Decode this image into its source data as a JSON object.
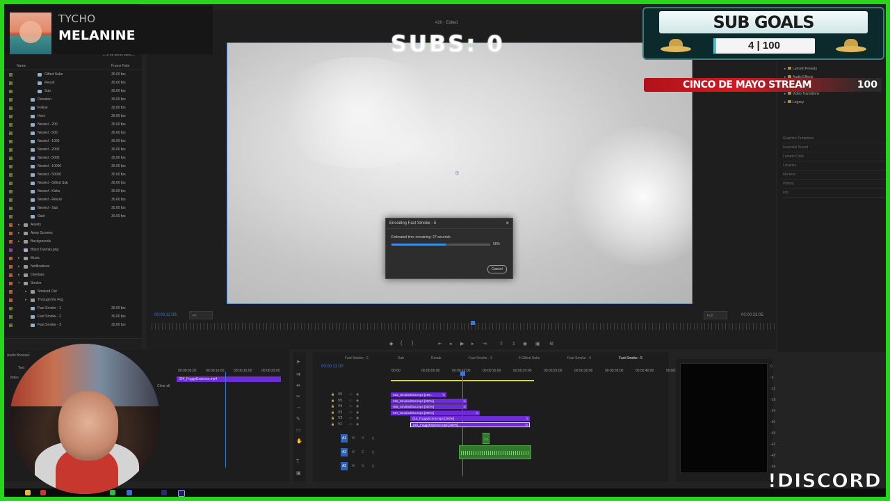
{
  "overlay": {
    "now_playing": {
      "artist": "TYCHO",
      "song": "MELANINE"
    },
    "subs_counter": "SUBS: 0",
    "sub_goals": {
      "title": "SUB GOALS",
      "current": "4",
      "separator": "|",
      "target": "100"
    },
    "stream_goal": {
      "label": "CINCO DE MAYO STREAM",
      "value": "100"
    },
    "discord": "!DISCORD"
  },
  "project_panel": {
    "item_count": "1 of 69 items selec...",
    "columns": {
      "name": "Name",
      "frame_rate": "Frame Rate"
    },
    "items": [
      {
        "name": "Gifted Subs",
        "rate": "30.00 fps",
        "indent": 3,
        "kind": "seq",
        "color": "#5f7f2a"
      },
      {
        "name": "Resub",
        "rate": "30.00 fps",
        "indent": 3,
        "kind": "seq",
        "color": "#5f7f2a"
      },
      {
        "name": "Sub",
        "rate": "30.00 fps",
        "indent": 3,
        "kind": "seq",
        "color": "#5f7f2a"
      },
      {
        "name": "Donation",
        "rate": "30.00 fps",
        "indent": 2,
        "kind": "seq",
        "color": "#5f7f2a"
      },
      {
        "name": "Follow",
        "rate": "30.00 fps",
        "indent": 2,
        "kind": "seq",
        "color": "#5f7f2a"
      },
      {
        "name": "Host",
        "rate": "30.00 fps",
        "indent": 2,
        "kind": "seq",
        "color": "#5f7f2a"
      },
      {
        "name": "Nested - 200",
        "rate": "30.00 fps",
        "indent": 2,
        "kind": "seq",
        "color": "#5f7f2a"
      },
      {
        "name": "Nested - 500",
        "rate": "30.00 fps",
        "indent": 2,
        "kind": "seq",
        "color": "#5f7f2a"
      },
      {
        "name": "Nested - 1000",
        "rate": "30.00 fps",
        "indent": 2,
        "kind": "seq",
        "color": "#5f7f2a"
      },
      {
        "name": "Nested - 2000",
        "rate": "30.00 fps",
        "indent": 2,
        "kind": "seq",
        "color": "#5f7f2a"
      },
      {
        "name": "Nested - 5000",
        "rate": "30.00 fps",
        "indent": 2,
        "kind": "seq",
        "color": "#5f7f2a"
      },
      {
        "name": "Nested - 10000",
        "rate": "30.00 fps",
        "indent": 2,
        "kind": "seq",
        "color": "#5f7f2a"
      },
      {
        "name": "Nested - 50000",
        "rate": "30.00 fps",
        "indent": 2,
        "kind": "seq",
        "color": "#5f7f2a"
      },
      {
        "name": "Nested - Gifted Sub",
        "rate": "30.00 fps",
        "indent": 2,
        "kind": "seq",
        "color": "#5f7f2a"
      },
      {
        "name": "Nested - Kicks",
        "rate": "30.00 fps",
        "indent": 2,
        "kind": "seq",
        "color": "#5f7f2a"
      },
      {
        "name": "Nested - Resub",
        "rate": "30.00 fps",
        "indent": 2,
        "kind": "seq",
        "color": "#5f7f2a"
      },
      {
        "name": "Nested - Sub",
        "rate": "30.00 fps",
        "indent": 2,
        "kind": "seq",
        "color": "#5f7f2a"
      },
      {
        "name": "Raid",
        "rate": "30.00 fps",
        "indent": 2,
        "kind": "seq",
        "color": "#5f7f2a"
      },
      {
        "name": "Assets",
        "rate": "",
        "indent": 1,
        "kind": "bin",
        "color": "#c05a2b"
      },
      {
        "name": "Away Screens",
        "rate": "",
        "indent": 1,
        "kind": "bin",
        "color": "#c05a2b"
      },
      {
        "name": "Backgrounds",
        "rate": "",
        "indent": 1,
        "kind": "bin",
        "color": "#c05a2b"
      },
      {
        "name": "Black Overlay.png",
        "rate": "",
        "indent": 1,
        "kind": "img",
        "color": "#8a3ab0"
      },
      {
        "name": "Music",
        "rate": "",
        "indent": 1,
        "kind": "bin",
        "color": "#c05a2b"
      },
      {
        "name": "Notifications",
        "rate": "",
        "indent": 1,
        "kind": "bin",
        "color": "#c05a2b"
      },
      {
        "name": "Overlays",
        "rate": "",
        "indent": 1,
        "kind": "bin",
        "color": "#c05a2b"
      },
      {
        "name": "Smoke",
        "rate": "",
        "indent": 1,
        "kind": "bin-open",
        "color": "#c05a2b"
      },
      {
        "name": "Smoked Out",
        "rate": "",
        "indent": 2,
        "kind": "bin",
        "color": "#c05a2b"
      },
      {
        "name": "Through the Fog",
        "rate": "",
        "indent": 2,
        "kind": "bin",
        "color": "#c05a2b"
      },
      {
        "name": "Fast Smoke - 1",
        "rate": "30.00 fps",
        "indent": 2,
        "kind": "seq",
        "color": "#5f7f2a"
      },
      {
        "name": "Fast Smoke - 2",
        "rate": "30.00 fps",
        "indent": 2,
        "kind": "seq",
        "color": "#5f7f2a"
      },
      {
        "name": "Fast Smoke - 3",
        "rate": "30.00 fps",
        "indent": 2,
        "kind": "seq",
        "color": "#5f7f2a"
      }
    ]
  },
  "program_monitor": {
    "title": "420 - Edited",
    "timecode_left": "00:00:12:09",
    "fit": "Fit",
    "quality": "Full",
    "timecode_right": "00:00:23:05"
  },
  "encode_dialog": {
    "title": "Encoding Fast Smoke - 5",
    "estimate": "Estimated time remaining: 27 seconds",
    "progress": 0.55,
    "percent": "55%",
    "cancel": "Cancel"
  },
  "right_panel": {
    "items": [
      "Lumetri Presets",
      "Audio Effects",
      "Video Effects",
      "Video Transitions",
      "Legacy"
    ],
    "sections": [
      "Graphics Templates",
      "Essential Sound",
      "Lumetri Color",
      "Libraries",
      "Markers",
      "History",
      "Info"
    ]
  },
  "source_panel": {
    "ruler": [
      "00:00:05:00",
      "00:00:10:00",
      "00:00:15:00",
      "00:00:20:00"
    ],
    "clip": "024_FoggyEssence.mp4",
    "labels": [
      "Audio Browser",
      "Text",
      "Video",
      "Clear all"
    ]
  },
  "timeline": {
    "tabs": [
      "Fast Smoke - 2",
      "Sub",
      "Resub",
      "Fast Smoke - 3",
      "5 Gifted Subs",
      "Fast Smoke - 4",
      "Fast Smoke - 5"
    ],
    "active_tab": "Fast Smoke - 5",
    "timecode": "00:00:12:00",
    "ruler": [
      ":00:00",
      "00:00:05:00",
      "00:00:10:00",
      "00:00:15:00",
      "00:00:20:00",
      "00:00:25:00",
      "00:00:30:00",
      "00:00:35:00",
      "00:00:40:00",
      "00:00:45:00"
    ],
    "video_tracks": [
      "V6",
      "V5",
      "V4",
      "V3",
      "V2",
      "V1"
    ],
    "audio_tracks": [
      "A1",
      "A2",
      "A3"
    ],
    "clips": [
      {
        "track": "V6",
        "label": "012_SmokedOut.mp4 [109..."
      },
      {
        "track": "V5",
        "label": "016_SmokedOut.mp4 [300%]"
      },
      {
        "track": "V4",
        "label": "005_SmokedOut.mp4 [300%]"
      },
      {
        "track": "V3",
        "label": "017_SmokedOut.mp4 [300%]"
      },
      {
        "track": "V2",
        "label": "016_FoggyEchos.mp4 [300%]"
      },
      {
        "track": "V1",
        "label": "024_FoggyEssence.mp4 [300%]"
      }
    ],
    "fx": "fx"
  },
  "meter": {
    "db": [
      "0",
      "-6",
      "-12",
      "-18",
      "-24",
      "-30",
      "-36",
      "-42",
      "-48",
      "-54"
    ]
  }
}
